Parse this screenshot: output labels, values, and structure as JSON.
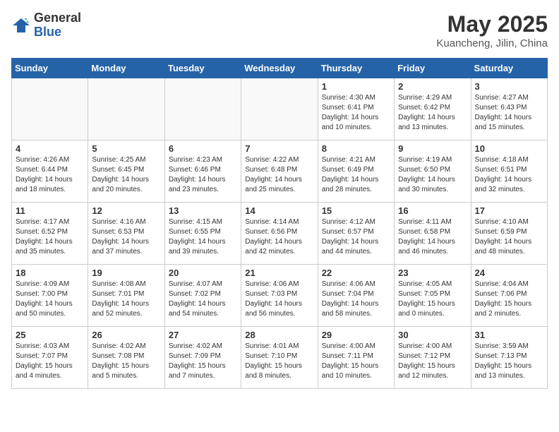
{
  "logo": {
    "general": "General",
    "blue": "Blue"
  },
  "title": "May 2025",
  "location": "Kuancheng, Jilin, China",
  "weekdays": [
    "Sunday",
    "Monday",
    "Tuesday",
    "Wednesday",
    "Thursday",
    "Friday",
    "Saturday"
  ],
  "weeks": [
    [
      {
        "day": "",
        "info": ""
      },
      {
        "day": "",
        "info": ""
      },
      {
        "day": "",
        "info": ""
      },
      {
        "day": "",
        "info": ""
      },
      {
        "day": "1",
        "info": "Sunrise: 4:30 AM\nSunset: 6:41 PM\nDaylight: 14 hours\nand 10 minutes."
      },
      {
        "day": "2",
        "info": "Sunrise: 4:29 AM\nSunset: 6:42 PM\nDaylight: 14 hours\nand 13 minutes."
      },
      {
        "day": "3",
        "info": "Sunrise: 4:27 AM\nSunset: 6:43 PM\nDaylight: 14 hours\nand 15 minutes."
      }
    ],
    [
      {
        "day": "4",
        "info": "Sunrise: 4:26 AM\nSunset: 6:44 PM\nDaylight: 14 hours\nand 18 minutes."
      },
      {
        "day": "5",
        "info": "Sunrise: 4:25 AM\nSunset: 6:45 PM\nDaylight: 14 hours\nand 20 minutes."
      },
      {
        "day": "6",
        "info": "Sunrise: 4:23 AM\nSunset: 6:46 PM\nDaylight: 14 hours\nand 23 minutes."
      },
      {
        "day": "7",
        "info": "Sunrise: 4:22 AM\nSunset: 6:48 PM\nDaylight: 14 hours\nand 25 minutes."
      },
      {
        "day": "8",
        "info": "Sunrise: 4:21 AM\nSunset: 6:49 PM\nDaylight: 14 hours\nand 28 minutes."
      },
      {
        "day": "9",
        "info": "Sunrise: 4:19 AM\nSunset: 6:50 PM\nDaylight: 14 hours\nand 30 minutes."
      },
      {
        "day": "10",
        "info": "Sunrise: 4:18 AM\nSunset: 6:51 PM\nDaylight: 14 hours\nand 32 minutes."
      }
    ],
    [
      {
        "day": "11",
        "info": "Sunrise: 4:17 AM\nSunset: 6:52 PM\nDaylight: 14 hours\nand 35 minutes."
      },
      {
        "day": "12",
        "info": "Sunrise: 4:16 AM\nSunset: 6:53 PM\nDaylight: 14 hours\nand 37 minutes."
      },
      {
        "day": "13",
        "info": "Sunrise: 4:15 AM\nSunset: 6:55 PM\nDaylight: 14 hours\nand 39 minutes."
      },
      {
        "day": "14",
        "info": "Sunrise: 4:14 AM\nSunset: 6:56 PM\nDaylight: 14 hours\nand 42 minutes."
      },
      {
        "day": "15",
        "info": "Sunrise: 4:12 AM\nSunset: 6:57 PM\nDaylight: 14 hours\nand 44 minutes."
      },
      {
        "day": "16",
        "info": "Sunrise: 4:11 AM\nSunset: 6:58 PM\nDaylight: 14 hours\nand 46 minutes."
      },
      {
        "day": "17",
        "info": "Sunrise: 4:10 AM\nSunset: 6:59 PM\nDaylight: 14 hours\nand 48 minutes."
      }
    ],
    [
      {
        "day": "18",
        "info": "Sunrise: 4:09 AM\nSunset: 7:00 PM\nDaylight: 14 hours\nand 50 minutes."
      },
      {
        "day": "19",
        "info": "Sunrise: 4:08 AM\nSunset: 7:01 PM\nDaylight: 14 hours\nand 52 minutes."
      },
      {
        "day": "20",
        "info": "Sunrise: 4:07 AM\nSunset: 7:02 PM\nDaylight: 14 hours\nand 54 minutes."
      },
      {
        "day": "21",
        "info": "Sunrise: 4:06 AM\nSunset: 7:03 PM\nDaylight: 14 hours\nand 56 minutes."
      },
      {
        "day": "22",
        "info": "Sunrise: 4:06 AM\nSunset: 7:04 PM\nDaylight: 14 hours\nand 58 minutes."
      },
      {
        "day": "23",
        "info": "Sunrise: 4:05 AM\nSunset: 7:05 PM\nDaylight: 15 hours\nand 0 minutes."
      },
      {
        "day": "24",
        "info": "Sunrise: 4:04 AM\nSunset: 7:06 PM\nDaylight: 15 hours\nand 2 minutes."
      }
    ],
    [
      {
        "day": "25",
        "info": "Sunrise: 4:03 AM\nSunset: 7:07 PM\nDaylight: 15 hours\nand 4 minutes."
      },
      {
        "day": "26",
        "info": "Sunrise: 4:02 AM\nSunset: 7:08 PM\nDaylight: 15 hours\nand 5 minutes."
      },
      {
        "day": "27",
        "info": "Sunrise: 4:02 AM\nSunset: 7:09 PM\nDaylight: 15 hours\nand 7 minutes."
      },
      {
        "day": "28",
        "info": "Sunrise: 4:01 AM\nSunset: 7:10 PM\nDaylight: 15 hours\nand 8 minutes."
      },
      {
        "day": "29",
        "info": "Sunrise: 4:00 AM\nSunset: 7:11 PM\nDaylight: 15 hours\nand 10 minutes."
      },
      {
        "day": "30",
        "info": "Sunrise: 4:00 AM\nSunset: 7:12 PM\nDaylight: 15 hours\nand 12 minutes."
      },
      {
        "day": "31",
        "info": "Sunrise: 3:59 AM\nSunset: 7:13 PM\nDaylight: 15 hours\nand 13 minutes."
      }
    ]
  ]
}
